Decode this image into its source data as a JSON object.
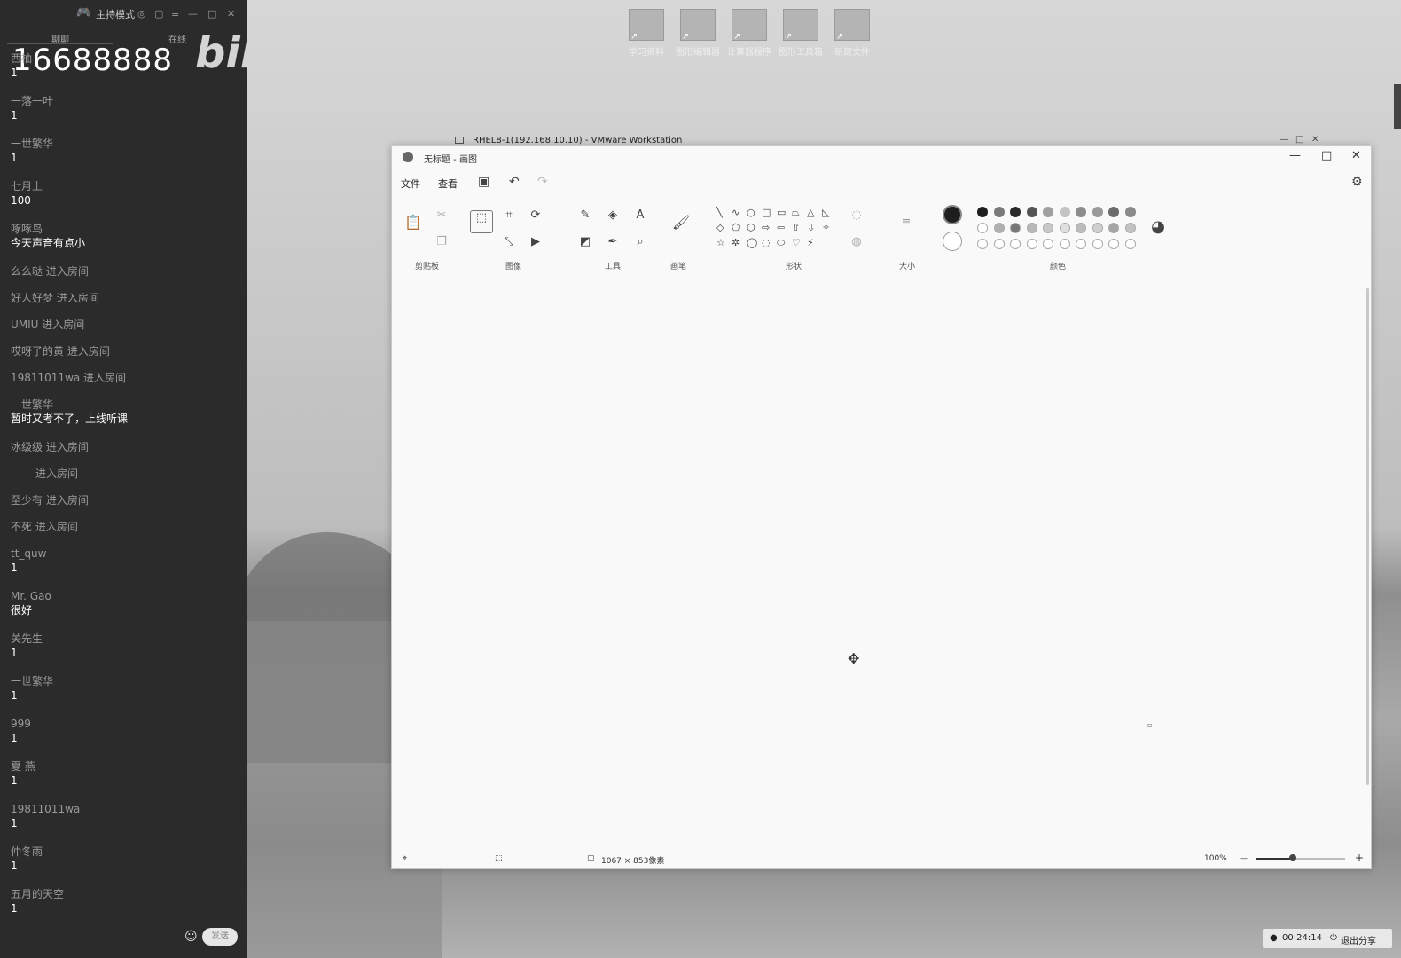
{
  "chat_panel": {
    "mode_label": "主持模式",
    "tabs": [
      "聊聊",
      "在线"
    ],
    "room_number": "16688888",
    "logo_text": "bilibili",
    "messages": [
      {
        "user": "西柚",
        "text": "1"
      },
      {
        "user": "一落一叶",
        "text": "1"
      },
      {
        "user": "一世繁华",
        "text": "1"
      },
      {
        "user": "七月上",
        "text": "100"
      },
      {
        "user": "啄啄鸟",
        "text": "今天声音有点小"
      },
      {
        "enter": "么么哒 进入房间"
      },
      {
        "enter": "好人好梦 进入房间"
      },
      {
        "enter": "UMIU 进入房间"
      },
      {
        "enter": "哎呀了的黄 进入房间"
      },
      {
        "enter": "19811011wa 进入房间"
      },
      {
        "user": "一世繁华",
        "text": "暂时又考不了，上线听课"
      },
      {
        "enter": "冰级级 进入房间"
      },
      {
        "enter": "进入房间"
      },
      {
        "enter": "至少有 进入房间"
      },
      {
        "enter": "不死 进入房间"
      },
      {
        "user": "tt_quw",
        "text": "1"
      },
      {
        "user": "Mr. Gao",
        "text": "很好"
      },
      {
        "user": "关先生",
        "text": "1"
      },
      {
        "user": "一世繁华",
        "text": "1"
      },
      {
        "user": "999",
        "text": "1"
      },
      {
        "user": "夏 燕",
        "text": "1"
      },
      {
        "user": "19811011wa",
        "text": "1"
      },
      {
        "user": "仲冬雨",
        "text": "1"
      },
      {
        "user": "五月的天空",
        "text": "1"
      }
    ],
    "send_label": "发送"
  },
  "desktop": {
    "icons": [
      "学习资料",
      "图形编辑器",
      "计算器程序",
      "图形工具箱",
      "新建文件"
    ]
  },
  "vmware": {
    "title": "RHEL8-1(192.168.10.10) - VMware Workstation"
  },
  "paint": {
    "title": "无标题 - 画图",
    "menu": [
      "文件",
      "查看"
    ],
    "groups": [
      "剪贴板",
      "图像",
      "工具",
      "画笔",
      "形状",
      "大小",
      "颜色"
    ],
    "status_size": "1067 × 853像素",
    "zoom": "100%",
    "colors_row1": [
      "#1e1e1e",
      "#7a7a7a",
      "#2b2b2b",
      "#555555",
      "#a0a0a0",
      "#c4c4c4",
      "#8c8c8c",
      "#9a9a9a",
      "#6c6c6c",
      "#8a8a8a"
    ],
    "colors_row2": [
      "#ffffff",
      "#b0b0b0",
      "#777777",
      "#b8b8b8",
      "#c8c8c8",
      "#e0e0e0",
      "#bcbcbc",
      "#cfcfcf",
      "#a5a5a5",
      "#c2c2c2"
    ]
  },
  "tray": {
    "time": "00:24:14",
    "exit_share": "退出分享"
  }
}
